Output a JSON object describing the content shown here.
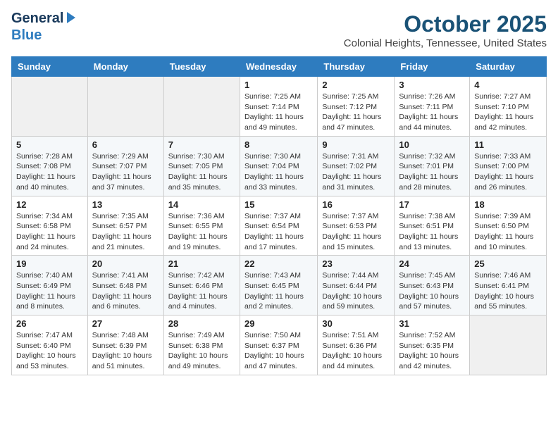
{
  "header": {
    "logo_line1": "General",
    "logo_line2": "Blue",
    "month": "October 2025",
    "location": "Colonial Heights, Tennessee, United States"
  },
  "weekdays": [
    "Sunday",
    "Monday",
    "Tuesday",
    "Wednesday",
    "Thursday",
    "Friday",
    "Saturday"
  ],
  "weeks": [
    [
      {
        "day": "",
        "info": ""
      },
      {
        "day": "",
        "info": ""
      },
      {
        "day": "",
        "info": ""
      },
      {
        "day": "1",
        "info": "Sunrise: 7:25 AM\nSunset: 7:14 PM\nDaylight: 11 hours\nand 49 minutes."
      },
      {
        "day": "2",
        "info": "Sunrise: 7:25 AM\nSunset: 7:12 PM\nDaylight: 11 hours\nand 47 minutes."
      },
      {
        "day": "3",
        "info": "Sunrise: 7:26 AM\nSunset: 7:11 PM\nDaylight: 11 hours\nand 44 minutes."
      },
      {
        "day": "4",
        "info": "Sunrise: 7:27 AM\nSunset: 7:10 PM\nDaylight: 11 hours\nand 42 minutes."
      }
    ],
    [
      {
        "day": "5",
        "info": "Sunrise: 7:28 AM\nSunset: 7:08 PM\nDaylight: 11 hours\nand 40 minutes."
      },
      {
        "day": "6",
        "info": "Sunrise: 7:29 AM\nSunset: 7:07 PM\nDaylight: 11 hours\nand 37 minutes."
      },
      {
        "day": "7",
        "info": "Sunrise: 7:30 AM\nSunset: 7:05 PM\nDaylight: 11 hours\nand 35 minutes."
      },
      {
        "day": "8",
        "info": "Sunrise: 7:30 AM\nSunset: 7:04 PM\nDaylight: 11 hours\nand 33 minutes."
      },
      {
        "day": "9",
        "info": "Sunrise: 7:31 AM\nSunset: 7:02 PM\nDaylight: 11 hours\nand 31 minutes."
      },
      {
        "day": "10",
        "info": "Sunrise: 7:32 AM\nSunset: 7:01 PM\nDaylight: 11 hours\nand 28 minutes."
      },
      {
        "day": "11",
        "info": "Sunrise: 7:33 AM\nSunset: 7:00 PM\nDaylight: 11 hours\nand 26 minutes."
      }
    ],
    [
      {
        "day": "12",
        "info": "Sunrise: 7:34 AM\nSunset: 6:58 PM\nDaylight: 11 hours\nand 24 minutes."
      },
      {
        "day": "13",
        "info": "Sunrise: 7:35 AM\nSunset: 6:57 PM\nDaylight: 11 hours\nand 21 minutes."
      },
      {
        "day": "14",
        "info": "Sunrise: 7:36 AM\nSunset: 6:55 PM\nDaylight: 11 hours\nand 19 minutes."
      },
      {
        "day": "15",
        "info": "Sunrise: 7:37 AM\nSunset: 6:54 PM\nDaylight: 11 hours\nand 17 minutes."
      },
      {
        "day": "16",
        "info": "Sunrise: 7:37 AM\nSunset: 6:53 PM\nDaylight: 11 hours\nand 15 minutes."
      },
      {
        "day": "17",
        "info": "Sunrise: 7:38 AM\nSunset: 6:51 PM\nDaylight: 11 hours\nand 13 minutes."
      },
      {
        "day": "18",
        "info": "Sunrise: 7:39 AM\nSunset: 6:50 PM\nDaylight: 11 hours\nand 10 minutes."
      }
    ],
    [
      {
        "day": "19",
        "info": "Sunrise: 7:40 AM\nSunset: 6:49 PM\nDaylight: 11 hours\nand 8 minutes."
      },
      {
        "day": "20",
        "info": "Sunrise: 7:41 AM\nSunset: 6:48 PM\nDaylight: 11 hours\nand 6 minutes."
      },
      {
        "day": "21",
        "info": "Sunrise: 7:42 AM\nSunset: 6:46 PM\nDaylight: 11 hours\nand 4 minutes."
      },
      {
        "day": "22",
        "info": "Sunrise: 7:43 AM\nSunset: 6:45 PM\nDaylight: 11 hours\nand 2 minutes."
      },
      {
        "day": "23",
        "info": "Sunrise: 7:44 AM\nSunset: 6:44 PM\nDaylight: 10 hours\nand 59 minutes."
      },
      {
        "day": "24",
        "info": "Sunrise: 7:45 AM\nSunset: 6:43 PM\nDaylight: 10 hours\nand 57 minutes."
      },
      {
        "day": "25",
        "info": "Sunrise: 7:46 AM\nSunset: 6:41 PM\nDaylight: 10 hours\nand 55 minutes."
      }
    ],
    [
      {
        "day": "26",
        "info": "Sunrise: 7:47 AM\nSunset: 6:40 PM\nDaylight: 10 hours\nand 53 minutes."
      },
      {
        "day": "27",
        "info": "Sunrise: 7:48 AM\nSunset: 6:39 PM\nDaylight: 10 hours\nand 51 minutes."
      },
      {
        "day": "28",
        "info": "Sunrise: 7:49 AM\nSunset: 6:38 PM\nDaylight: 10 hours\nand 49 minutes."
      },
      {
        "day": "29",
        "info": "Sunrise: 7:50 AM\nSunset: 6:37 PM\nDaylight: 10 hours\nand 47 minutes."
      },
      {
        "day": "30",
        "info": "Sunrise: 7:51 AM\nSunset: 6:36 PM\nDaylight: 10 hours\nand 44 minutes."
      },
      {
        "day": "31",
        "info": "Sunrise: 7:52 AM\nSunset: 6:35 PM\nDaylight: 10 hours\nand 42 minutes."
      },
      {
        "day": "",
        "info": ""
      }
    ]
  ]
}
